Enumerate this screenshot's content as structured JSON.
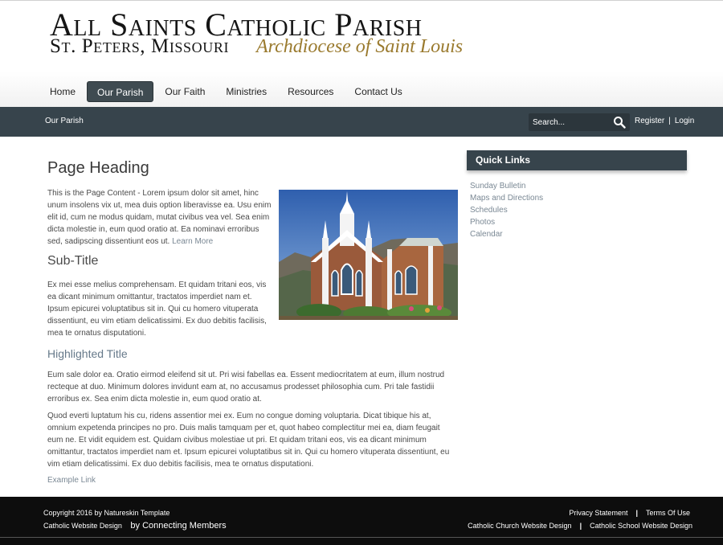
{
  "header": {
    "title": "All Saints Catholic Parish",
    "subtitle": "St. Peters, Missouri",
    "archdiocese": "Archdiocese of Saint Louis"
  },
  "nav": {
    "items": [
      {
        "label": "Home"
      },
      {
        "label": "Our Parish"
      },
      {
        "label": "Our Faith"
      },
      {
        "label": "Ministries"
      },
      {
        "label": "Resources"
      },
      {
        "label": "Contact Us"
      }
    ],
    "active": "Our Parish"
  },
  "subbar": {
    "breadcrumb": "Our Parish",
    "search_placeholder": "Search...",
    "register": "Register",
    "separator": "|",
    "login": "Login"
  },
  "main": {
    "heading": "Page Heading",
    "intro": "This is the Page Content - Lorem ipsum dolor sit amet, hinc unum insolens vix ut, mea duis option liberavisse ea. Usu enim elit id, cum ne modus quidam, mutat civibus vea vel. Sea enim dicta molestie in, eum quod oratio at. Ea nominavi erroribus sed, sadipscing dissentiunt eos ut.",
    "learn_more": "Learn More",
    "subtitle": "Sub-Title",
    "para2": "Ex mei esse melius comprehensam. Et quidam tritani eos, vis ea dicant minimum omittantur, tractatos imperdiet nam et. Ipsum epicurei voluptatibus sit in. Qui cu homero vituperata dissentiunt, eu vim etiam delicatissimi. Ex duo debitis facilisis, mea te ornatus disputationi.",
    "highlighted_title": "Highlighted Title",
    "para3": "Eum sale dolor ea. Oratio eirmod eleifend sit ut. Pri wisi fabellas ea. Essent mediocritatem at eum, illum nostrud recteque at duo. Minimum dolores invidunt eam at, no accusamus prodesset philosophia cum. Pri tale fastidii erroribus ex. Sea enim dicta molestie in, eum quod oratio at.",
    "para4": "Quod everti luptatum his cu, ridens assentior mei ex. Eum no congue doming voluptaria. Dicat tibique his at, omnium expetenda principes no pro. Duis malis tamquam per et, quot habeo complectitur mei ea, diam feugait eum ne. Et vidit equidem est. Quidam civibus molestiae ut pri. Et quidam tritani eos, vis ea dicant minimum omittantur, tractatos imperdiet nam et. Ipsum epicurei voluptatibus sit in. Qui cu homero vituperata dissentiunt, eu vim etiam delicatissimi. Ex duo debitis facilisis, mea te ornatus disputationi.",
    "example_link": "Example Link"
  },
  "sidebar": {
    "title": "Quick Links",
    "links": [
      "Sunday Bulletin",
      "Maps and Directions",
      "Schedules",
      "Photos",
      "Calendar"
    ]
  },
  "footer": {
    "copyright": "Copyright 2016 by Natureskin Template",
    "design_label": "Catholic Website Design",
    "by_label": "by Connecting Members",
    "privacy": "Privacy Statement",
    "terms": "Terms Of Use",
    "church_design": "Catholic Church Website Design",
    "school_design": "Catholic School Website Design",
    "separator": "|"
  },
  "icons": {
    "search": "search-icon"
  },
  "colors": {
    "nav_dark": "#37444c",
    "accent_gold": "#9a7a2e",
    "link": "#7a8894",
    "footer": "#0d0d0d"
  }
}
